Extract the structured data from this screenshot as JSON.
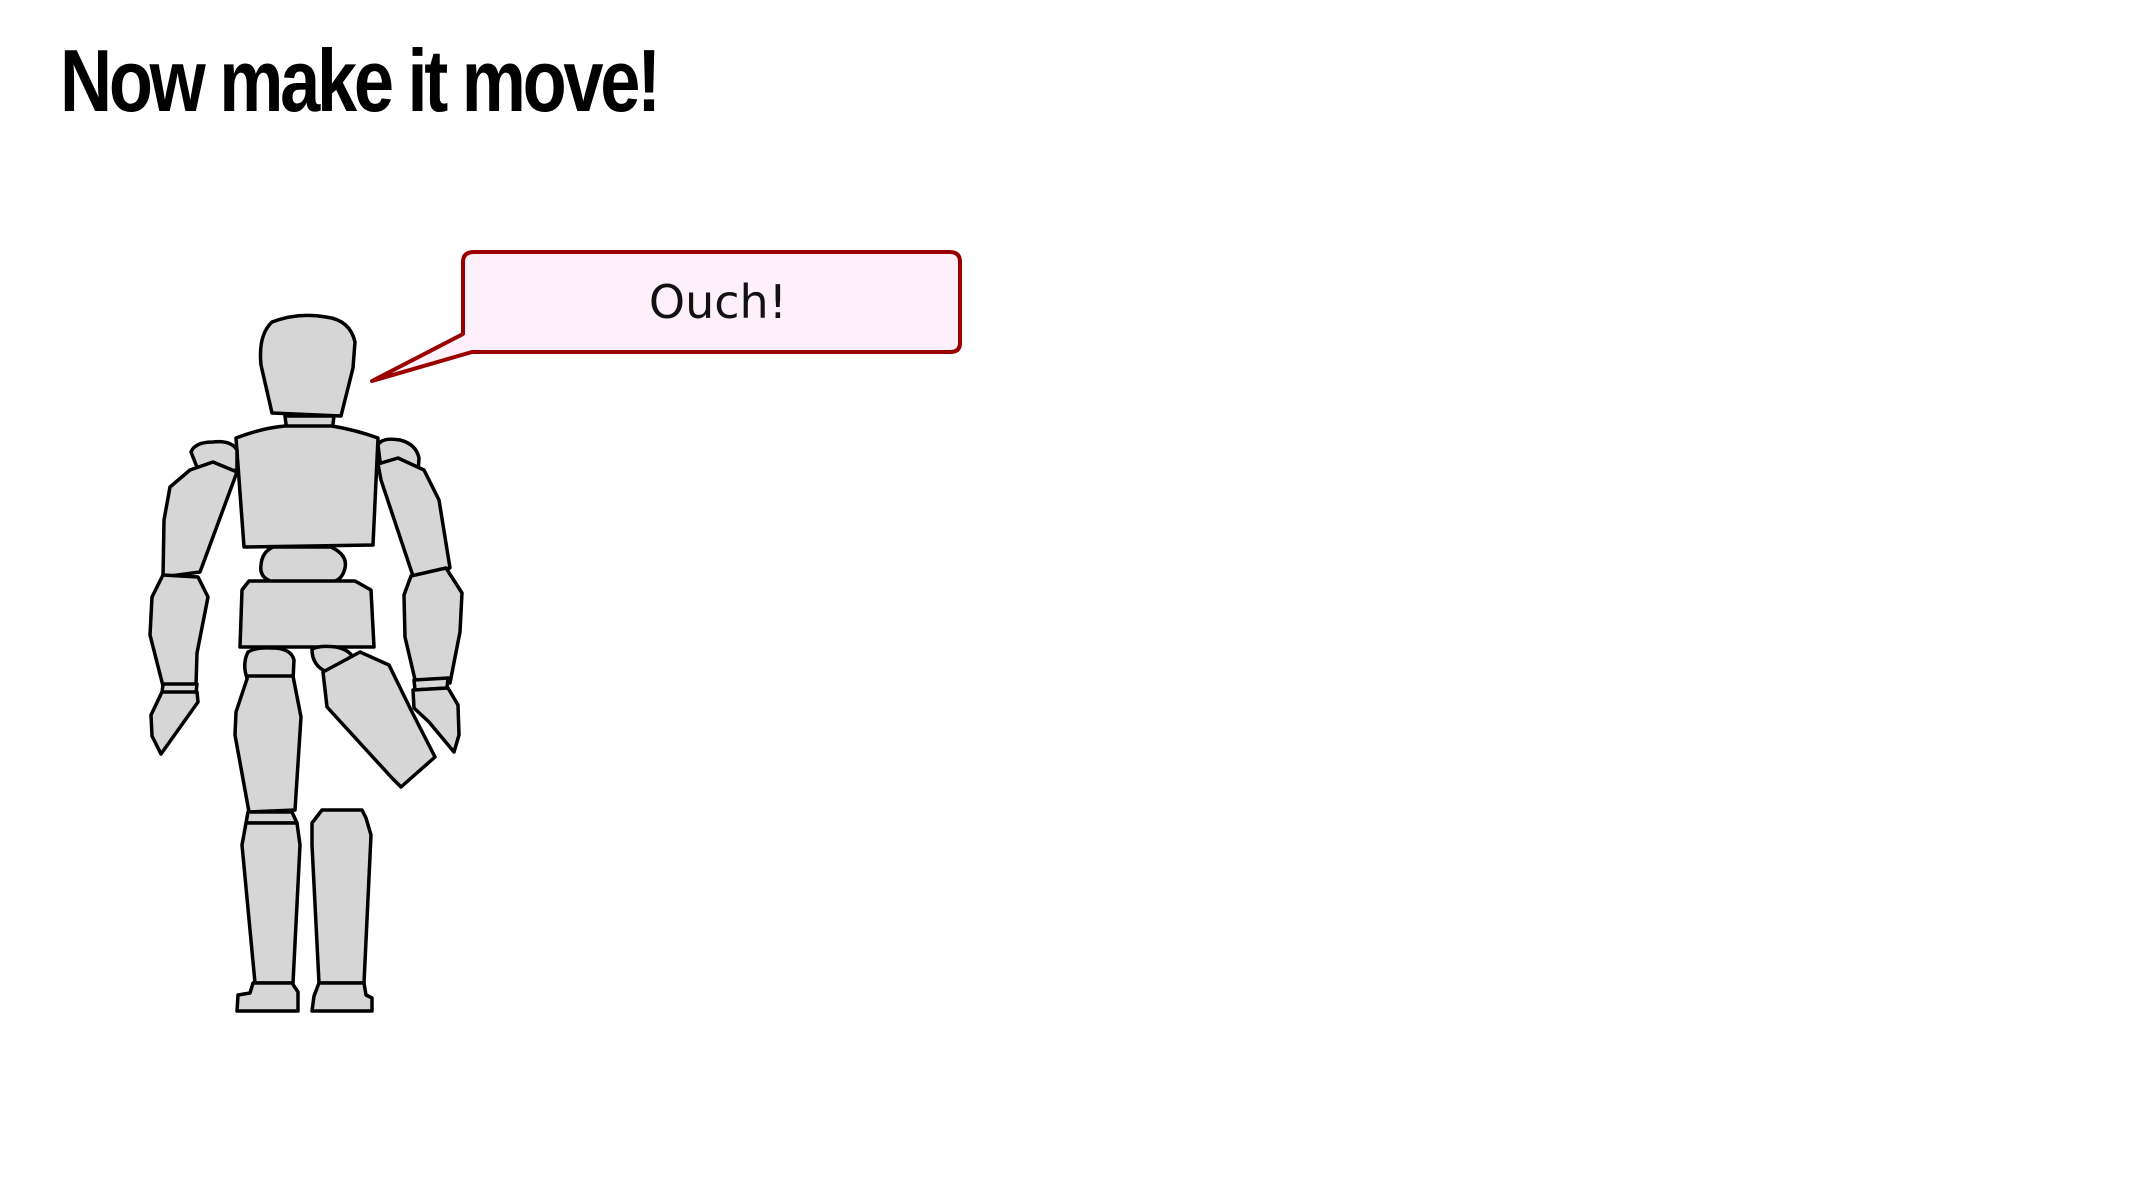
{
  "slide": {
    "title": "Now make it move!"
  },
  "speech_bubble": {
    "text": "Ouch!",
    "fill_color": "#fdf0fa",
    "border_color": "#9a0000"
  },
  "figure": {
    "icon": "wooden-mannequin-icon",
    "body_color": "#d6d6d6",
    "outline_color": "#000000"
  }
}
